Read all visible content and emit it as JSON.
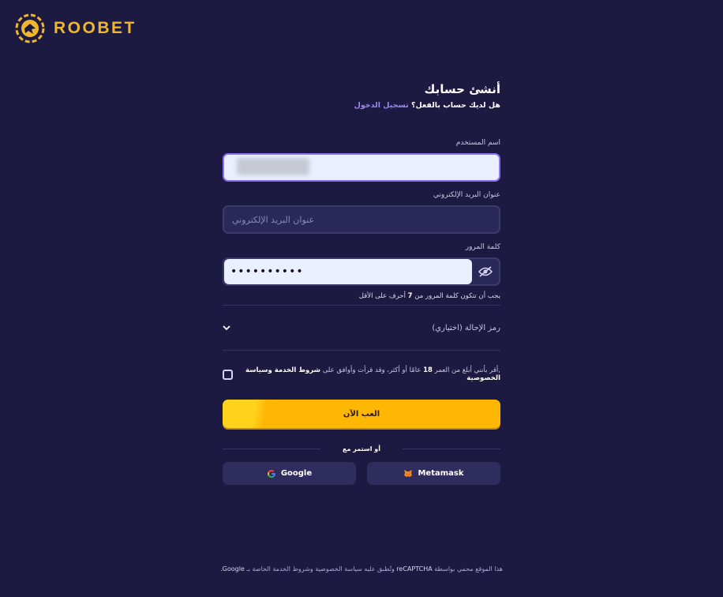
{
  "brand": {
    "name": "ROOBET",
    "color": "#f0b72d"
  },
  "form": {
    "title": "أنشئ حسابك",
    "have_account": "هل لديك حساب بالفعل؟",
    "login_link": "تسجيل الدخول",
    "username_label": "اسم المستخدم",
    "email_label": "عنوان البريد الإلكتروني",
    "email_placeholder": "عنوان البريد الإلكتروني",
    "password_label": "كلمة المرور",
    "password_value": "••••••••••",
    "password_hint_pre": "يجب أن تتكون كلمة المرور من",
    "password_hint_num": "7",
    "password_hint_post": "أحرف على الأقل",
    "referral_label": "رمز الإحالة (اختياري)",
    "agree_pre": ",أقر بأنني أبلغ من العمر",
    "agree_age": "18",
    "agree_mid": "عامًا أو أكثر، وقد قرأت وأوافق على",
    "agree_terms": "شروط الخدمة وسياسة الخصوصية",
    "play_button": "العب الآن",
    "or_continue": "أو استمر مع",
    "google": "Google",
    "metamask": "Metamask"
  },
  "footer": {
    "text_pre": "هذا الموقع محمي بواسطة",
    "recaptcha": "reCAPTCHA",
    "text_mid": "وتُطبق عليه سياسة الخصوصية وشروط الخدمة الخاصة بـ",
    "google": "Google."
  },
  "colors": {
    "background": "#1c1a40",
    "accent": "#ffb703",
    "link": "#9c87f5"
  }
}
